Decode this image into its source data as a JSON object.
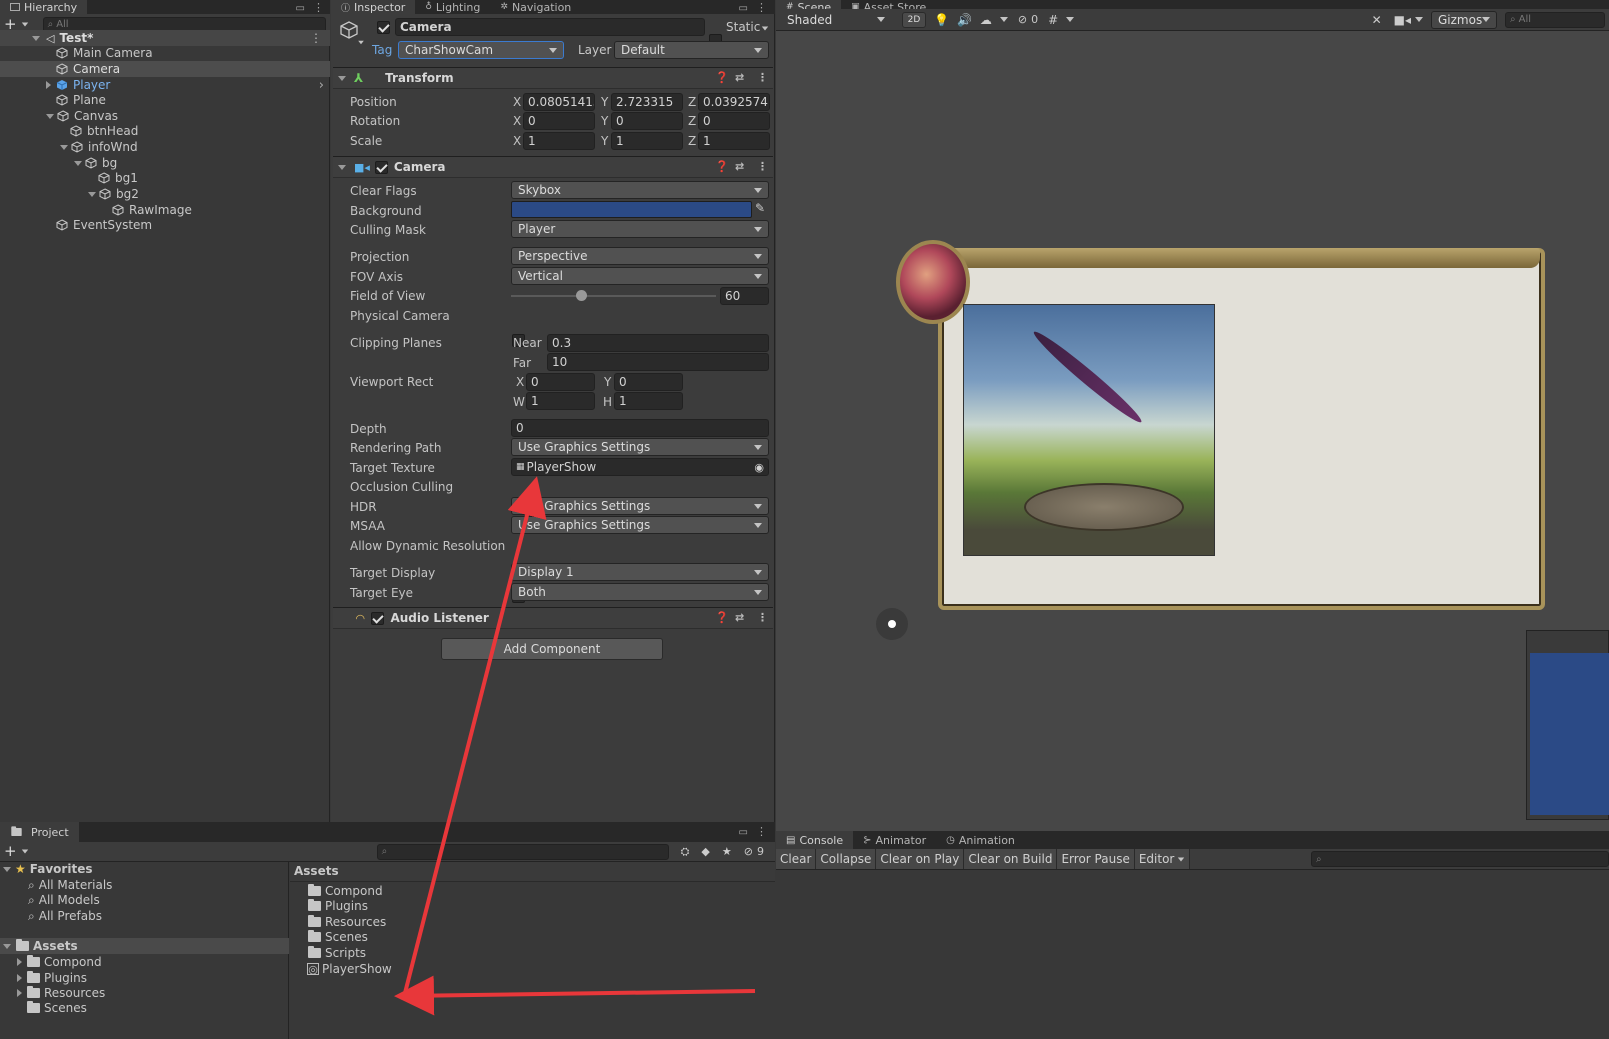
{
  "hierarchy": {
    "tab": "Hierarchy",
    "search_placeholder": "All",
    "scene": "Test*",
    "items": [
      {
        "label": "Main Camera"
      },
      {
        "label": "Camera"
      },
      {
        "label": "Player"
      },
      {
        "label": "Plane"
      },
      {
        "label": "Canvas"
      },
      {
        "label": "btnHead"
      },
      {
        "label": "infoWnd"
      },
      {
        "label": "bg"
      },
      {
        "label": "bg1"
      },
      {
        "label": "bg2"
      },
      {
        "label": "RawImage"
      },
      {
        "label": "EventSystem"
      }
    ]
  },
  "inspector": {
    "tabs": [
      "Inspector",
      "Lighting",
      "Navigation"
    ],
    "object_name": "Camera",
    "static_label": "Static",
    "tag_label": "Tag",
    "tag_value": "CharShowCam",
    "layer_label": "Layer",
    "layer_value": "Default",
    "transform": {
      "title": "Transform",
      "position_label": "Position",
      "rotation_label": "Rotation",
      "scale_label": "Scale",
      "position": {
        "x": "0.08051413",
        "y": "2.723315",
        "z": "0.03925741"
      },
      "rotation": {
        "x": "0",
        "y": "0",
        "z": "0"
      },
      "scale": {
        "x": "1",
        "y": "1",
        "z": "1"
      }
    },
    "camera": {
      "title": "Camera",
      "clear_flags_label": "Clear Flags",
      "clear_flags": "Skybox",
      "background_label": "Background",
      "background_color": "#2b4a86",
      "culling_mask_label": "Culling Mask",
      "culling_mask": "Player",
      "projection_label": "Projection",
      "projection": "Perspective",
      "fov_axis_label": "FOV Axis",
      "fov_axis": "Vertical",
      "fov_label": "Field of View",
      "fov": "60",
      "fov_slider_fraction": 0.34,
      "physical_label": "Physical Camera",
      "clipping_label": "Clipping Planes",
      "near_label": "Near",
      "near": "0.3",
      "far_label": "Far",
      "far": "10",
      "viewport_label": "Viewport Rect",
      "vx": "0",
      "vy": "0",
      "vw": "1",
      "vh": "1",
      "depth_label": "Depth",
      "depth": "0",
      "rendering_path_label": "Rendering Path",
      "rendering_path": "Use Graphics Settings",
      "target_texture_label": "Target Texture",
      "target_texture": "PlayerShow",
      "occlusion_label": "Occlusion Culling",
      "hdr_label": "HDR",
      "hdr": "Use Graphics Settings",
      "msaa_label": "MSAA",
      "msaa": "Use Graphics Settings",
      "dynres_label": "Allow Dynamic Resolution",
      "target_display_label": "Target Display",
      "target_display": "Display 1",
      "target_eye_label": "Target Eye",
      "target_eye": "Both"
    },
    "audio_listener": "Audio Listener",
    "add_component": "Add Component"
  },
  "scene": {
    "tabs": [
      "Scene",
      "Asset Store"
    ],
    "shading": "Shaded",
    "mode_2d": "2D",
    "hidden_count": "0",
    "gizmos": "Gizmos",
    "search_placeholder": "All"
  },
  "project": {
    "tab": "Project",
    "hidden_count": "9",
    "favorites_label": "Favorites",
    "favorites": [
      "All Materials",
      "All Models",
      "All Prefabs"
    ],
    "assets_label": "Assets",
    "tree": [
      "Compond",
      "Plugins",
      "Resources",
      "Scenes"
    ],
    "assets_header": "Assets",
    "files": [
      "Compond",
      "Plugins",
      "Resources",
      "Scenes",
      "Scripts",
      "PlayerShow"
    ]
  },
  "console": {
    "tabs": [
      "Console",
      "Animator",
      "Animation"
    ],
    "buttons": [
      "Clear",
      "Collapse",
      "Clear on Play",
      "Clear on Build",
      "Error Pause",
      "Editor"
    ]
  }
}
